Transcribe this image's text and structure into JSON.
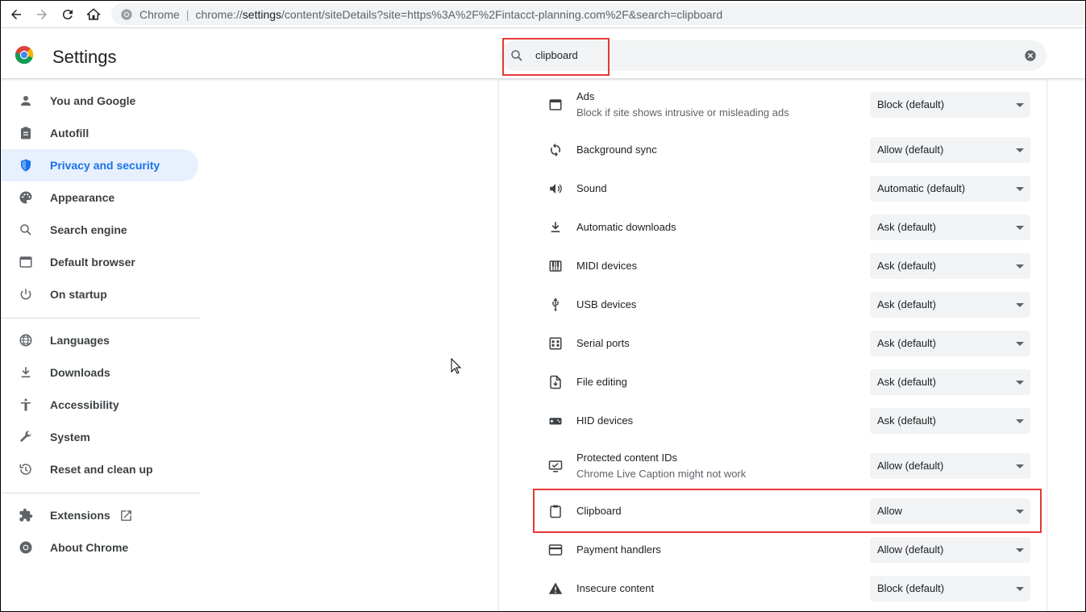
{
  "browser": {
    "omnibox": {
      "site_chip": "Chrome",
      "url_prefix": "chrome://",
      "url_host": "settings",
      "url_path": "/content/siteDetails?site=https%3A%2F%2Fintacct-planning.com%2F&search=clipboard"
    }
  },
  "header": {
    "title": "Settings",
    "search_value": "clipboard"
  },
  "sidebar": {
    "items": [
      {
        "label": "You and Google",
        "icon": "person-icon"
      },
      {
        "label": "Autofill",
        "icon": "clipboard-list-icon"
      },
      {
        "label": "Privacy and security",
        "icon": "shield-icon",
        "active": true
      },
      {
        "label": "Appearance",
        "icon": "palette-icon"
      },
      {
        "label": "Search engine",
        "icon": "search-icon"
      },
      {
        "label": "Default browser",
        "icon": "browser-window-icon"
      },
      {
        "label": "On startup",
        "icon": "power-icon"
      },
      {
        "label": "Languages",
        "icon": "globe-icon"
      },
      {
        "label": "Downloads",
        "icon": "download-icon"
      },
      {
        "label": "Accessibility",
        "icon": "accessibility-icon"
      },
      {
        "label": "System",
        "icon": "wrench-icon"
      },
      {
        "label": "Reset and clean up",
        "icon": "restore-icon"
      },
      {
        "label": "Extensions",
        "icon": "puzzle-icon"
      },
      {
        "label": "About Chrome",
        "icon": "chrome-icon"
      }
    ]
  },
  "permissions": [
    {
      "label": "Ads",
      "sub": "Block if site shows intrusive or misleading ads",
      "value": "Block (default)",
      "icon": "ads-window-icon"
    },
    {
      "label": "Background sync",
      "value": "Allow (default)",
      "icon": "sync-icon"
    },
    {
      "label": "Sound",
      "value": "Automatic (default)",
      "icon": "speaker-icon"
    },
    {
      "label": "Automatic downloads",
      "value": "Ask (default)",
      "icon": "download-icon"
    },
    {
      "label": "MIDI devices",
      "value": "Ask (default)",
      "icon": "piano-icon"
    },
    {
      "label": "USB devices",
      "value": "Ask (default)",
      "icon": "usb-icon"
    },
    {
      "label": "Serial ports",
      "value": "Ask (default)",
      "icon": "serial-port-icon"
    },
    {
      "label": "File editing",
      "value": "Ask (default)",
      "icon": "file-edit-icon"
    },
    {
      "label": "HID devices",
      "value": "Ask (default)",
      "icon": "gamepad-icon"
    },
    {
      "label": "Protected content IDs",
      "sub": "Chrome Live Caption might not work",
      "value": "Allow (default)",
      "icon": "protected-content-icon"
    },
    {
      "label": "Clipboard",
      "value": "Allow",
      "icon": "clipboard-icon"
    },
    {
      "label": "Payment handlers",
      "value": "Allow (default)",
      "icon": "credit-card-icon"
    },
    {
      "label": "Insecure content",
      "value": "Block (default)",
      "icon": "warning-icon"
    }
  ],
  "colors": {
    "accent": "#1a73e8",
    "active_nav_bg": "#e8f0fe",
    "highlight": "#e53935"
  }
}
